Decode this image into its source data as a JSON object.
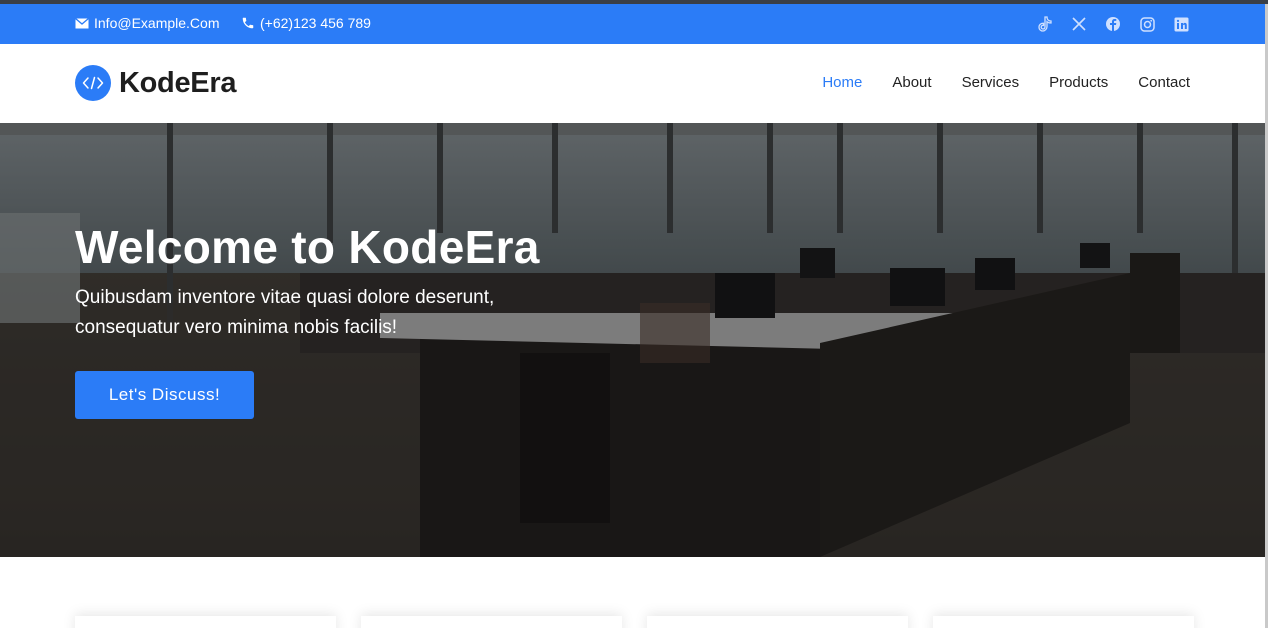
{
  "topbar": {
    "email": "Info@Example.Com",
    "phone": "(+62)123 456 789",
    "socials": [
      "tiktok-icon",
      "x-icon",
      "facebook-icon",
      "instagram-icon",
      "linkedin-icon"
    ]
  },
  "brand": {
    "name": "KodeEra"
  },
  "nav": {
    "items": [
      {
        "label": "Home",
        "active": true
      },
      {
        "label": "About"
      },
      {
        "label": "Services"
      },
      {
        "label": "Products"
      },
      {
        "label": "Contact"
      }
    ]
  },
  "hero": {
    "title": "Welcome to KodeEra",
    "subtitle": "Quibusdam inventore vitae quasi dolore deserunt, consequatur vero minima nobis facilis!",
    "cta": "Let's Discuss!"
  },
  "colors": {
    "accent": "#2b7cf7",
    "text_dark": "#1e1e1e",
    "white": "#ffffff"
  }
}
